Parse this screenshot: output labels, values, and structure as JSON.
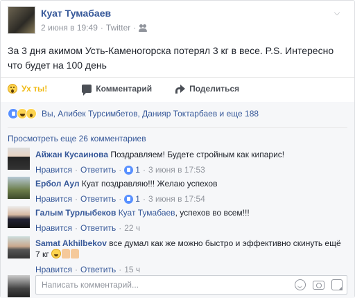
{
  "post": {
    "author": "Куат Тумабаев",
    "date": "2 июня в 19:49",
    "separator": "·",
    "source": "Twitter",
    "text": "За 3 дня акимом Усть-Каменогорска потерял 3 кг в весе. P.S. Интересно что будет на 100 день",
    "privacy_icon": "friends-icon",
    "menu_icon": "chevron-down-icon"
  },
  "actions": {
    "wow_label": "Ух ты!",
    "comment_label": "Комментарий",
    "share_label": "Поделиться"
  },
  "reactions": {
    "icons": [
      "like-icon",
      "haha-icon",
      "wow-icon"
    ],
    "summary": "Вы, Алибек Турсимбетов, Данияр Токтарбаев и еще 188"
  },
  "more_comments": "Просмотреть еще 26 комментариев",
  "comments": [
    {
      "name": "Айжан Кусаинова",
      "text": "Поздравляем! Будете стройным как кипарис!",
      "like": "Нравится",
      "reply": "Ответить",
      "likes": "1",
      "time": "3 июня в 17:53"
    },
    {
      "name": "Ербол Аул",
      "text": "Куат поздравляю!!! Желаю успехов",
      "like": "Нравится",
      "reply": "Ответить",
      "likes": "1",
      "time": "3 июня в 17:54"
    },
    {
      "name": "Галым Турлыбеков",
      "mention": "Куат Тумабаев",
      "text": ", успехов во всем!!!",
      "like": "Нравится",
      "reply": "Ответить",
      "time": "22 ч"
    },
    {
      "name": "Samat Akhilbekov",
      "text": "все думал как же можно быстро и эффективно скинуть ещё 7 кг",
      "like": "Нравится",
      "reply": "Ответить",
      "time": "15 ч"
    }
  ],
  "comment_input": {
    "placeholder": "Написать комментарий..."
  },
  "colors": {
    "link": "#365899",
    "meta": "#90949c",
    "wow": "#f0ba15",
    "like_blue": "#5890ff",
    "comments_bg": "#f6f7f9"
  }
}
